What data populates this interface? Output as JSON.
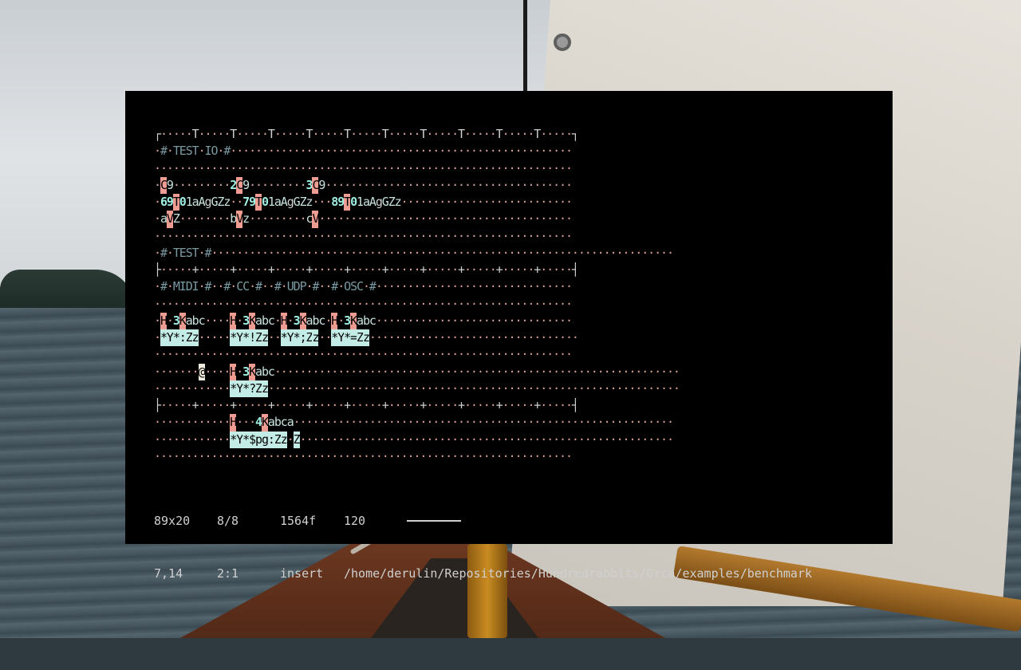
{
  "grid": {
    "cols": 89,
    "rows": [
      "┌·····T·····T·····T·····T·····T·····T·····T·····T·····T·····T·····┐",
      "·#·TEST·IO·#······················································",
      "··································································",
      "·C9·········2C9·········3C9·······································",
      "·69T01aAgGZz··79T01aAgGZz···89T01aAgGZz···························",
      "·aVZ········bVz·········cV········································",
      "··································································",
      "·#·TEST·#·········································································",
      "├·····+·····+·····+·····+·····+·····+·····+·····+·····+·····+·····┤",
      "·#·MIDI·#··#·CC·#··#·UDP·#··#·OSC·#·······························",
      "··································································",
      "·H·3Kabc····H·3Kabc·H·3Kabc·H·3Kabc·······························",
      "·*Y*:Zz·····*Y*!Zz··*Y*;Zz··*Y*=Zz·································",
      "··································································",
      "·······@····H·3Kabc································································",
      "············*Y*?Zz·································································",
      "├·····+·····+·····+·····+·····+·····+·····+·····+·····+·····+·····┤",
      "············H···4Kabca····························································",
      "············*Y*$pg:Zz·Z···························································",
      "··································································"
    ]
  },
  "status": {
    "size": "89x20",
    "frame_ratio": "8/8",
    "frame": "1564f",
    "bpm": "120",
    "bpm_level": 0.62,
    "cursor": "7,14",
    "selection": "2:1",
    "mode": "insert",
    "path": "/home/derulin/Repositories/Hundredrabbits/Orca/examples/benchmark"
  },
  "colors": {
    "background": "#000000",
    "operator": "#ef9c93",
    "number": "#9ff0e3",
    "highlight": "#c4ece6",
    "dot": "#d7a099",
    "comment": "#7a9aa3"
  }
}
